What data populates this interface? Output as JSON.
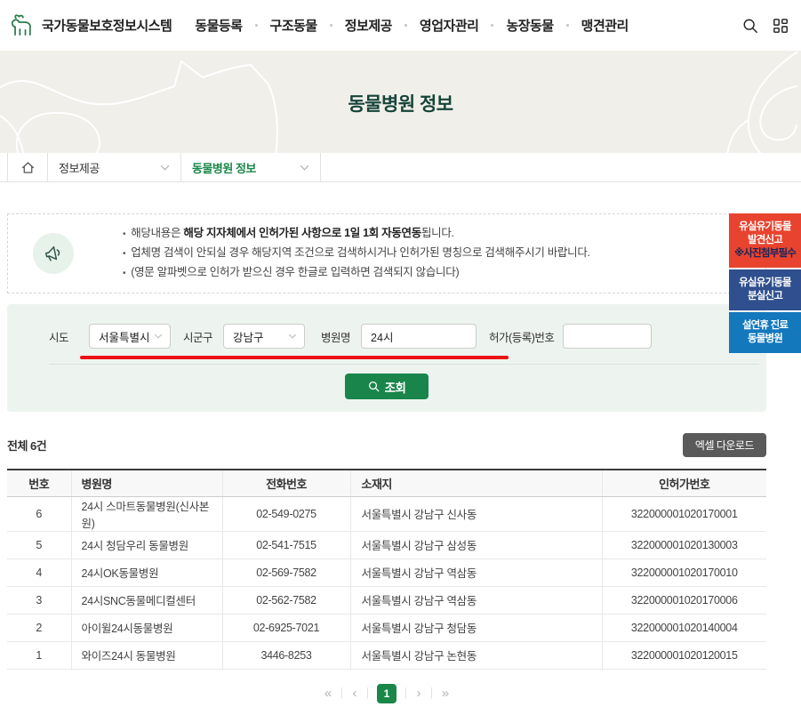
{
  "header": {
    "logo_text": "국가동물보호정보시스템",
    "nav": [
      "동물등록",
      "구조동물",
      "정보제공",
      "영업자관리",
      "농장동물",
      "맹견관리"
    ]
  },
  "hero": {
    "title": "동물병원 정보"
  },
  "breadcrumb": {
    "level1": "정보제공",
    "level2": "동물병원 정보"
  },
  "notice": {
    "line1_prefix": "해당내용은 ",
    "line1_bold": "해당 지자체에서 인허가된 사항으로 1일 1회 자동연동",
    "line1_suffix": "됩니다.",
    "line2": "업체명 검색이 안되실 경우 해당지역 조건으로 검색하시거나 인허가된 명칭으로 검색해주시기 바랍니다.",
    "line3": "(영문 알파벳으로 인허가 받으신 경우 한글로 입력하면 검색되지 않습니다)"
  },
  "floating_buttons": [
    {
      "line1": "유실유기동물",
      "line2": "발견신고",
      "line3": "※사진첨부필수",
      "color": "#e8432e"
    },
    {
      "line1": "유실유기동물",
      "line2": "분실신고",
      "color": "#2f4f8e"
    },
    {
      "line1": "설연휴 진료",
      "line2": "동물병원",
      "color": "#1478bd"
    }
  ],
  "search_form": {
    "sido_label": "시도",
    "sido_value": "서울특별시",
    "sigungu_label": "시군구",
    "sigungu_value": "강남구",
    "hospital_label": "병원명",
    "hospital_value": "24시",
    "license_label": "허가(등록)번호",
    "license_value": "",
    "submit_label": "조회"
  },
  "results": {
    "total_text": "전체 6건",
    "excel_button": "엑셀 다운로드",
    "table": {
      "headers": [
        "번호",
        "병원명",
        "전화번호",
        "소재지",
        "인허가번호"
      ],
      "rows": [
        [
          "6",
          "24시 스마트동물병원(신사본원)",
          "02-549-0275",
          "서울특별시 강남구 신사동",
          "322000001020170001"
        ],
        [
          "5",
          "24시 청담우리 동물병원",
          "02-541-7515",
          "서울특별시 강남구 삼성동",
          "322000001020130003"
        ],
        [
          "4",
          "24시OK동물병원",
          "02-569-7582",
          "서울특별시 강남구 역삼동",
          "322000001020170010"
        ],
        [
          "3",
          "24시SNC동물메디컬센터",
          "02-562-7582",
          "서울특별시 강남구 역삼동",
          "322000001020170006"
        ],
        [
          "2",
          "아이윌24시동물병원",
          "02-6925-7021",
          "서울특별시 강남구 청담동",
          "322000001020140004"
        ],
        [
          "1",
          "와이즈24시 동물병원",
          "3446-8253",
          "서울특별시 강남구 논현동",
          "322000001020120015"
        ]
      ]
    },
    "pagination": {
      "first": "«",
      "prev": "‹",
      "current": "1",
      "next": "›",
      "last": "»"
    }
  },
  "colors": {
    "accent_green": "#1a8749",
    "title_green": "#16443a",
    "report_red": "#e8432e",
    "lost_navy": "#2f4f8e",
    "holiday_blue": "#1478bd",
    "annotation_red": "#ee1111"
  }
}
